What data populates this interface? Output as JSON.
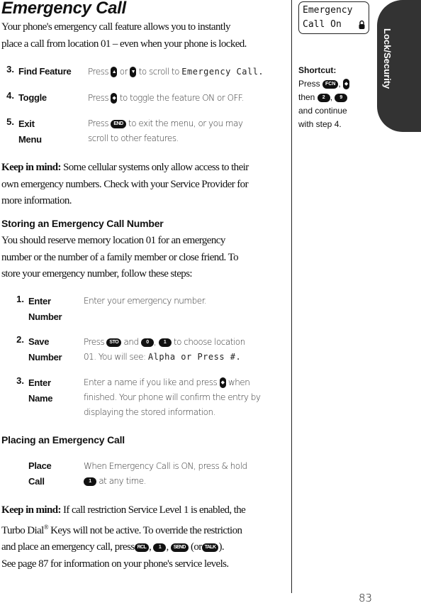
{
  "title": "Emergency Call",
  "intro": [
    "Your phone's emergency call feature allows you to instantly",
    "place a call from location 01 – even when your phone is locked."
  ],
  "steps_a": [
    {
      "num": "3.",
      "label": "Find Feature",
      "t1": "Press",
      "k1": "▲",
      "t2": "or",
      "k2": "▼",
      "t3": "to scroll to",
      "lcd": "Emergency Call."
    },
    {
      "num": "4.",
      "label": "Toggle",
      "t1": "Press",
      "k1": "◆",
      "t2": "to toggle the feature ON or OFF."
    },
    {
      "num": "5.",
      "label1": "Exit",
      "label2": "Menu",
      "t1": "Press",
      "k1": "END",
      "t2": "to exit the menu, or you may",
      "t3": "scroll to other features."
    }
  ],
  "keep1": {
    "bold": "Keep in mind:",
    "l1": " Some cellular systems only allow access to their",
    "l2": "own emergency numbers. Check with your Service Provider for",
    "l3": "more information."
  },
  "storing": {
    "heading": "Storing an Emergency Call Number",
    "l1": "You should reserve memory location 01 for an emergency",
    "l2": "number or the number of a family member or close friend. To",
    "l3": "store your emergency number, follow these steps:"
  },
  "steps_b": [
    {
      "num": "1.",
      "label1": "Enter",
      "label2": "Number",
      "t1": "Enter your emergency number."
    },
    {
      "num": "2.",
      "label1": "Save",
      "label2": "Number",
      "t1": "Press",
      "k1": "STO",
      "t2": "and",
      "k2": "0",
      ",": ",",
      "k3": "1",
      "t3": "to choose location",
      "t4": "01. You will see:",
      "lcd": "Alpha or Press #."
    },
    {
      "num": "3.",
      "label1": "Enter",
      "label2": "Name",
      "t1": "Enter a name if you like and press",
      "k1": "◆",
      "t2": "when",
      "t3": "finished. Your phone will confirm the entry by",
      "t4": "displaying the stored information."
    }
  ],
  "placing": {
    "heading": "Placing an Emergency Call",
    "label1": "Place",
    "label2": "Call",
    "t1": "When Emergency Call is ON, press & hold",
    "k1": "1",
    "t2": "at any time."
  },
  "keep2": {
    "bold": "Keep in mind:",
    "l1": " If call restriction Service Level 1 is enabled, the",
    "l2a": "Turbo Dial",
    "reg": "®",
    "l2b": " Keys will not be active. To override the restriction",
    "l3a": "and place an emergency call, press",
    "k1": "RCL",
    "k2": "1",
    "k3": "SEND",
    "l3b": "(or",
    "k4": "TALK",
    "l3c": ").",
    "l4": "See page 87 for information on your phone's service levels."
  },
  "display": {
    "line1": "Emergency",
    "line2": "Call On",
    "icon": "lock-icon"
  },
  "shortcut": {
    "heading": "Shortcut:",
    "press": "Press",
    "k1": "FCN",
    "k2": "◆",
    "then": "then",
    "k3": "2",
    "k4": "9",
    "l3": "and continue",
    "l4": "with step 4."
  },
  "section_tab": "Lock/Security",
  "page_number": "83"
}
